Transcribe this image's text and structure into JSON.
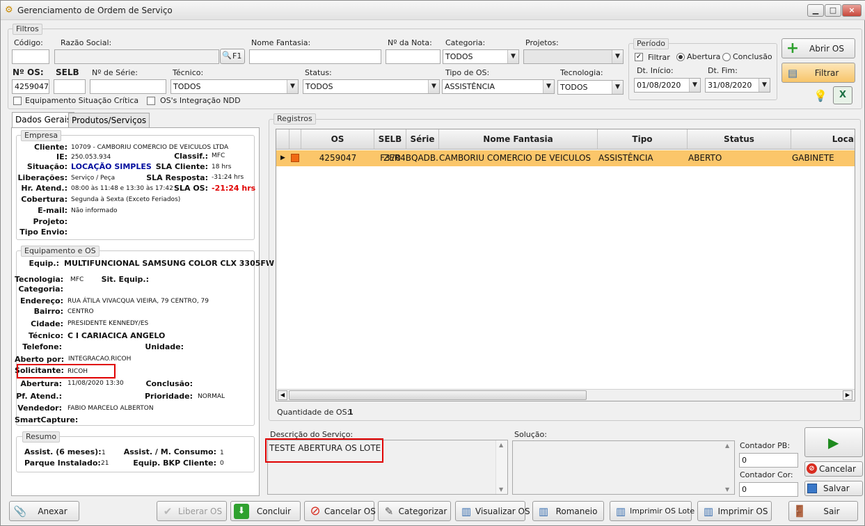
{
  "window": {
    "title": "Gerenciamento de Ordem de Serviço",
    "min": "▁",
    "max": "□",
    "close": "×"
  },
  "filters": {
    "legend": "Filtros",
    "codigo_label": "Código:",
    "codigo_value": "",
    "razao_label": "Razão Social:",
    "razao_value": "",
    "f1_label": "F1",
    "fantasia_label": "Nome Fantasia:",
    "fantasia_value": "",
    "nota_label": "Nº da Nota:",
    "nota_value": "",
    "categoria_label": "Categoria:",
    "categoria_value": "TODOS",
    "projetos_label": "Projetos:",
    "projetos_value": "",
    "os_label": "Nº OS:",
    "os_value": "4259047",
    "selb_label": "SELB",
    "selb_value": "",
    "serie_label": "Nº de Série:",
    "serie_value": "",
    "tecnico_label": "Técnico:",
    "tecnico_value": "TODOS",
    "status_label": "Status:",
    "status_value": "TODOS",
    "tipo_label": "Tipo de OS:",
    "tipo_value": "ASSISTÊNCIA",
    "tecnologia_label": "Tecnologia:",
    "tecnologia_value": "TODOS",
    "equip_critica": "Equipamento Situação Crítica",
    "integracao_ndd": "OS's Integração NDD"
  },
  "periodo": {
    "legend": "Período",
    "filtrar": "Filtrar",
    "abertura": "Abertura",
    "conclusao": "Conclusão",
    "inicio_label": "Dt. Início:",
    "inicio_value": "01/08/2020",
    "fim_label": "Dt. Fim:",
    "fim_value": "31/08/2020"
  },
  "actions": {
    "abrir_os": "Abrir OS",
    "filtrar": "Filtrar"
  },
  "tabs": [
    "Dados Gerais",
    "Produtos/Serviços"
  ],
  "empresa": {
    "legend": "Empresa",
    "rows": [
      {
        "k": "Cliente:",
        "v": "10709 - CAMBORIU COMERCIO DE VEICULOS LTDA"
      },
      {
        "k": "IE:",
        "v": "250.053.934"
      },
      {
        "k": "Situação:",
        "v": "LOCAÇÃO SIMPLES"
      },
      {
        "k": "Liberações:",
        "v": "Serviço / Peça"
      },
      {
        "k": "Hr. Atend.:",
        "v": "08:00 às 11:48 e 13:30 às 17:42"
      },
      {
        "k": "Cobertura:",
        "v": "Segunda à Sexta (Exceto Feriados)"
      },
      {
        "k": "E-mail:",
        "v": "Não informado"
      },
      {
        "k": "Projeto:",
        "v": ""
      },
      {
        "k": "Tipo Envio:",
        "v": ""
      }
    ],
    "classif_label": "Classif.:",
    "classif_value": "MFC",
    "sla_cliente_label": "SLA Cliente:",
    "sla_cliente_value": "18 hrs",
    "sla_resposta_label": "SLA Resposta:",
    "sla_resposta_value": "-31:24 hrs",
    "sla_os_label": "SLA OS:",
    "sla_os_value": "-21:24 hrs"
  },
  "equipamento": {
    "legend": "Equipamento e OS",
    "equip_label": "Equip.:",
    "equip_value": "MULTIFUNCIONAL SAMSUNG COLOR CLX 3305FW",
    "tecnologia_label": "Tecnologia:",
    "tecnologia_value": "MFC",
    "sit_label": "Sit. Equip.:",
    "sit_value": "",
    "categoria_label": "Categoria:",
    "categoria_value": "",
    "endereco_label": "Endereço:",
    "endereco_value": "RUA ÁTILA VIVACQUA VIEIRA, 79 CENTRO, 79",
    "bairro_label": "Bairro:",
    "bairro_value": "CENTRO",
    "cidade_label": "Cidade:",
    "cidade_value": "PRESIDENTE KENNEDY/ES",
    "tecnico_label": "Técnico:",
    "tecnico_value": "C I CARIACICA ANGELO",
    "telefone_label": "Telefone:",
    "telefone_value": "",
    "unidade_label": "Unidade:",
    "unidade_value": "",
    "aberto_label": "Aberto por:",
    "aberto_value": "INTEGRACAO.RICOH",
    "solicitante_label": "Solicitante:",
    "solicitante_value": "RICOH",
    "abertura_label": "Abertura:",
    "abertura_value": "11/08/2020 13:30",
    "conclusao_label": "Conclusão:",
    "conclusao_value": "",
    "pf_label": "Pf. Atend.:",
    "pf_value": "",
    "prioridade_label": "Prioridade:",
    "prioridade_value": "NORMAL",
    "vendedor_label": "Vendedor:",
    "vendedor_value": "FABIO MARCELO ALBERTON",
    "smart_label": "SmartCapture:",
    "smart_value": ""
  },
  "resumo": {
    "legend": "Resumo",
    "assist_label": "Assist. (6 meses):",
    "assist_value": "1",
    "consumo_label": "Assist. / M. Consumo:",
    "consumo_value": "1",
    "parque_label": "Parque Instalado:",
    "parque_value": "21",
    "bkp_label": "Equip. BKP Cliente:",
    "bkp_value": "0"
  },
  "registros": {
    "legend": "Registros",
    "columns": [
      "",
      "",
      "OS",
      "SELB",
      "Série",
      "Nome Fantasia",
      "Tipo",
      "Status",
      "Local"
    ],
    "rows": [
      {
        "os": "4259047",
        "selb": "F370",
        "serie": "ZER4BQADB...",
        "fantasia": "CAMBORIU COMERCIO DE VEICULOS",
        "tipo": "ASSISTÊNCIA",
        "status": "ABERTO",
        "local": "GABINETE"
      }
    ],
    "qtd_label": "Quantidade de OS:",
    "qtd_value": "1"
  },
  "descricao": {
    "label": "Descrição do Serviço:",
    "value": "TESTE ABERTURA OS LOTE"
  },
  "solucao": {
    "label": "Solução:",
    "value": ""
  },
  "contadores": {
    "pb_label": "Contador PB:",
    "pb_value": "0",
    "cor_label": "Contador Cor:",
    "cor_value": "0"
  },
  "side_buttons": {
    "cancelar": "Cancelar",
    "salvar": "Salvar"
  },
  "bottom_buttons": {
    "anexar": "Anexar",
    "liberar": "Liberar OS",
    "concluir": "Concluir",
    "cancelar_os": "Cancelar OS",
    "categorizar": "Categorizar",
    "visualizar": "Visualizar OS",
    "romaneio": "Romaneio",
    "imprimir_lote": "Imprimir OS Lote",
    "imprimir": "Imprimir OS",
    "sair": "Sair"
  },
  "colors": {
    "row_highlight": "#fbc66a",
    "sla_red": "#e00000",
    "situacao_blue": "#000c9e",
    "play_green": "#1e8a1e"
  }
}
